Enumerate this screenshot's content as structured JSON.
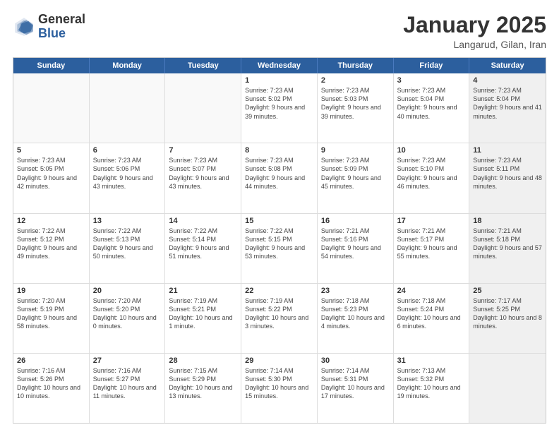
{
  "header": {
    "logo_general": "General",
    "logo_blue": "Blue",
    "month_title": "January 2025",
    "location": "Langarud, Gilan, Iran"
  },
  "calendar": {
    "days_of_week": [
      "Sunday",
      "Monday",
      "Tuesday",
      "Wednesday",
      "Thursday",
      "Friday",
      "Saturday"
    ],
    "rows": [
      [
        {
          "day": "",
          "empty": true
        },
        {
          "day": "",
          "empty": true
        },
        {
          "day": "",
          "empty": true
        },
        {
          "day": "1",
          "sunrise": "7:23 AM",
          "sunset": "5:02 PM",
          "daylight": "9 hours and 39 minutes."
        },
        {
          "day": "2",
          "sunrise": "7:23 AM",
          "sunset": "5:03 PM",
          "daylight": "9 hours and 39 minutes."
        },
        {
          "day": "3",
          "sunrise": "7:23 AM",
          "sunset": "5:04 PM",
          "daylight": "9 hours and 40 minutes."
        },
        {
          "day": "4",
          "sunrise": "7:23 AM",
          "sunset": "5:04 PM",
          "daylight": "9 hours and 41 minutes.",
          "shaded": true
        }
      ],
      [
        {
          "day": "5",
          "sunrise": "7:23 AM",
          "sunset": "5:05 PM",
          "daylight": "9 hours and 42 minutes."
        },
        {
          "day": "6",
          "sunrise": "7:23 AM",
          "sunset": "5:06 PM",
          "daylight": "9 hours and 43 minutes."
        },
        {
          "day": "7",
          "sunrise": "7:23 AM",
          "sunset": "5:07 PM",
          "daylight": "9 hours and 43 minutes."
        },
        {
          "day": "8",
          "sunrise": "7:23 AM",
          "sunset": "5:08 PM",
          "daylight": "9 hours and 44 minutes."
        },
        {
          "day": "9",
          "sunrise": "7:23 AM",
          "sunset": "5:09 PM",
          "daylight": "9 hours and 45 minutes."
        },
        {
          "day": "10",
          "sunrise": "7:23 AM",
          "sunset": "5:10 PM",
          "daylight": "9 hours and 46 minutes."
        },
        {
          "day": "11",
          "sunrise": "7:23 AM",
          "sunset": "5:11 PM",
          "daylight": "9 hours and 48 minutes.",
          "shaded": true
        }
      ],
      [
        {
          "day": "12",
          "sunrise": "7:22 AM",
          "sunset": "5:12 PM",
          "daylight": "9 hours and 49 minutes."
        },
        {
          "day": "13",
          "sunrise": "7:22 AM",
          "sunset": "5:13 PM",
          "daylight": "9 hours and 50 minutes."
        },
        {
          "day": "14",
          "sunrise": "7:22 AM",
          "sunset": "5:14 PM",
          "daylight": "9 hours and 51 minutes."
        },
        {
          "day": "15",
          "sunrise": "7:22 AM",
          "sunset": "5:15 PM",
          "daylight": "9 hours and 53 minutes."
        },
        {
          "day": "16",
          "sunrise": "7:21 AM",
          "sunset": "5:16 PM",
          "daylight": "9 hours and 54 minutes."
        },
        {
          "day": "17",
          "sunrise": "7:21 AM",
          "sunset": "5:17 PM",
          "daylight": "9 hours and 55 minutes."
        },
        {
          "day": "18",
          "sunrise": "7:21 AM",
          "sunset": "5:18 PM",
          "daylight": "9 hours and 57 minutes.",
          "shaded": true
        }
      ],
      [
        {
          "day": "19",
          "sunrise": "7:20 AM",
          "sunset": "5:19 PM",
          "daylight": "9 hours and 58 minutes."
        },
        {
          "day": "20",
          "sunrise": "7:20 AM",
          "sunset": "5:20 PM",
          "daylight": "10 hours and 0 minutes."
        },
        {
          "day": "21",
          "sunrise": "7:19 AM",
          "sunset": "5:21 PM",
          "daylight": "10 hours and 1 minute."
        },
        {
          "day": "22",
          "sunrise": "7:19 AM",
          "sunset": "5:22 PM",
          "daylight": "10 hours and 3 minutes."
        },
        {
          "day": "23",
          "sunrise": "7:18 AM",
          "sunset": "5:23 PM",
          "daylight": "10 hours and 4 minutes."
        },
        {
          "day": "24",
          "sunrise": "7:18 AM",
          "sunset": "5:24 PM",
          "daylight": "10 hours and 6 minutes."
        },
        {
          "day": "25",
          "sunrise": "7:17 AM",
          "sunset": "5:25 PM",
          "daylight": "10 hours and 8 minutes.",
          "shaded": true
        }
      ],
      [
        {
          "day": "26",
          "sunrise": "7:16 AM",
          "sunset": "5:26 PM",
          "daylight": "10 hours and 10 minutes."
        },
        {
          "day": "27",
          "sunrise": "7:16 AM",
          "sunset": "5:27 PM",
          "daylight": "10 hours and 11 minutes."
        },
        {
          "day": "28",
          "sunrise": "7:15 AM",
          "sunset": "5:29 PM",
          "daylight": "10 hours and 13 minutes."
        },
        {
          "day": "29",
          "sunrise": "7:14 AM",
          "sunset": "5:30 PM",
          "daylight": "10 hours and 15 minutes."
        },
        {
          "day": "30",
          "sunrise": "7:14 AM",
          "sunset": "5:31 PM",
          "daylight": "10 hours and 17 minutes."
        },
        {
          "day": "31",
          "sunrise": "7:13 AM",
          "sunset": "5:32 PM",
          "daylight": "10 hours and 19 minutes."
        },
        {
          "day": "",
          "empty": true,
          "shaded": true
        }
      ]
    ]
  }
}
